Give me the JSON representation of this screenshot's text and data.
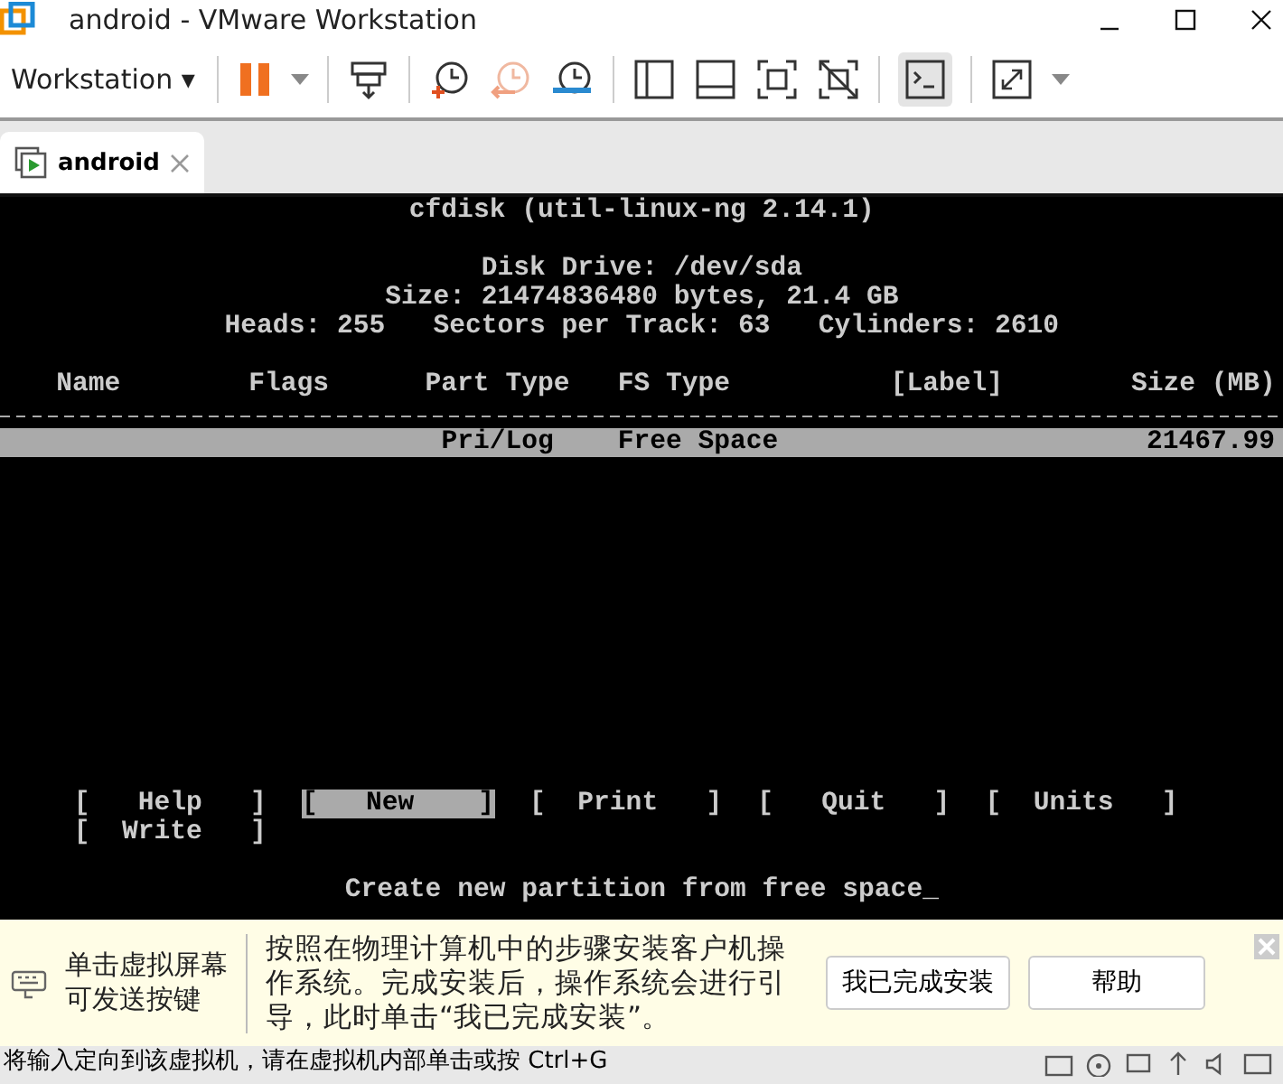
{
  "window": {
    "title": "android - VMware Workstation"
  },
  "toolbar": {
    "menu_label": "Workstation",
    "menu_caret": "▾"
  },
  "tabs": [
    {
      "label": "android",
      "selected": true
    }
  ],
  "terminal": {
    "title": "cfdisk (util-linux-ng 2.14.1)",
    "disk_info": [
      "Disk Drive: /dev/sda",
      "Size: 21474836480 bytes, 21.4 GB",
      "Heads: 255   Sectors per Track: 63   Cylinders: 2610"
    ],
    "columns": [
      "Name",
      "Flags",
      "Part Type",
      "FS Type",
      "[Label]",
      "Size (MB)"
    ],
    "rows": [
      {
        "part_type": "Pri/Log",
        "fs_type": "Free Space",
        "size": "21467.99",
        "selected": true
      }
    ],
    "menu": [
      {
        "label": "[   Help   ]",
        "selected": false
      },
      {
        "label": "[   New    ]",
        "selected": true
      },
      {
        "label": "[  Print   ]",
        "selected": false
      },
      {
        "label": "[   Quit   ]",
        "selected": false
      },
      {
        "label": "[  Units   ]",
        "selected": false
      },
      {
        "label": "[  Write   ]",
        "selected": false
      }
    ],
    "message": "Create new partition from free space_"
  },
  "hint_bar": {
    "key_hint": [
      "单击虚拟屏幕",
      "可发送按键"
    ],
    "message": "按照在物理计算机中的步骤安装客户机操作系统。完成安装后，操作系统会进行引导，此时单击“我已完成安装”。",
    "buttons": [
      "我已完成安装",
      "帮助"
    ]
  },
  "status_bar": {
    "text": "将输入定向到该虚拟机，请在虚拟机内部单击或按 Ctrl+G"
  }
}
